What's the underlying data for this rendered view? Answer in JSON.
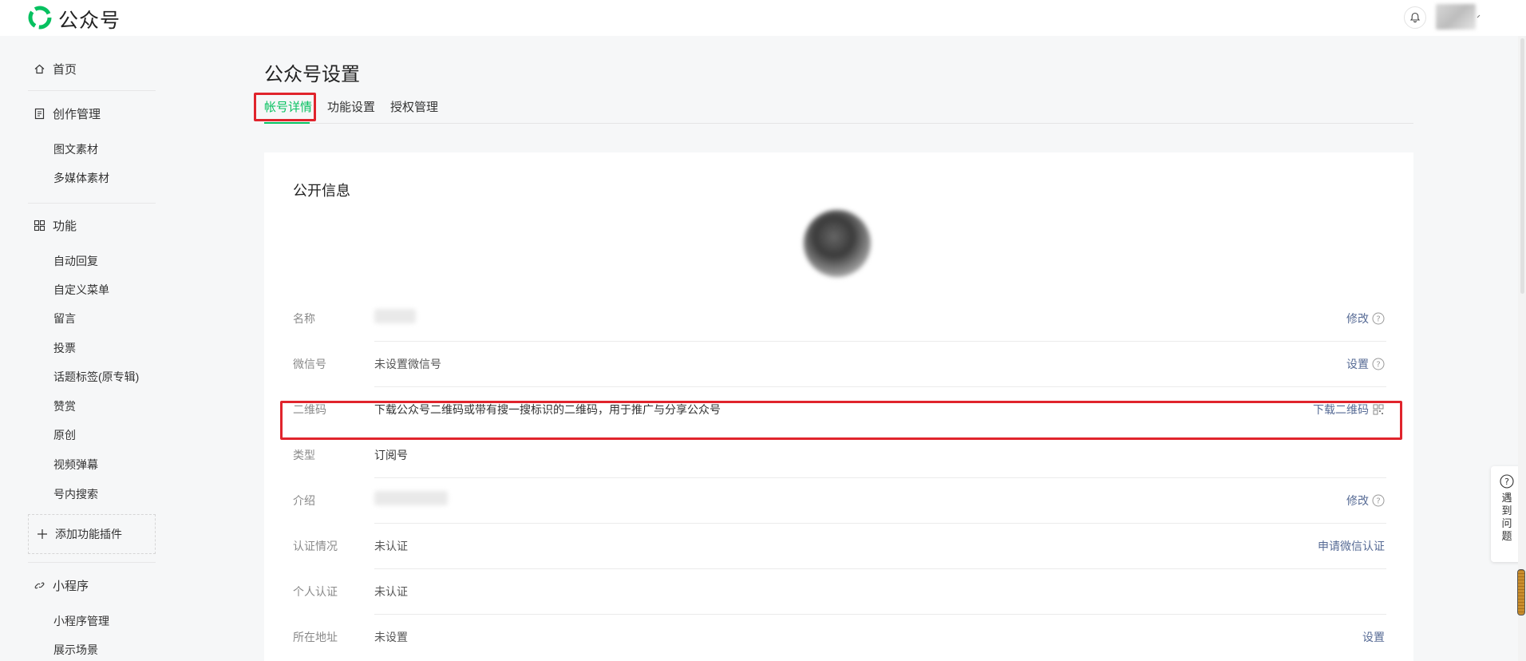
{
  "topbar": {
    "brand": "公众号",
    "brand_color": "#07c160"
  },
  "sidebar": {
    "home": "首页",
    "content": {
      "label": "创作管理",
      "items": [
        "图文素材",
        "多媒体素材"
      ]
    },
    "features": {
      "label": "功能",
      "items": [
        "自动回复",
        "自定义菜单",
        "留言",
        "投票",
        "话题标签(原专辑)",
        "赞赏",
        "原创",
        "视频弹幕",
        "号内搜索"
      ]
    },
    "add_plugin": "添加功能插件",
    "miniprogram": {
      "label": "小程序",
      "items": [
        "小程序管理",
        "展示场景"
      ]
    }
  },
  "main": {
    "title": "公众号设置",
    "tabs": [
      "帐号详情",
      "功能设置",
      "授权管理"
    ],
    "active_tab": "帐号详情",
    "section_title": "公开信息",
    "rows": [
      {
        "label": "名称",
        "value": "",
        "action": "修改"
      },
      {
        "label": "微信号",
        "value": "未设置微信号",
        "action": "设置"
      },
      {
        "label": "二维码",
        "value": "下载公众号二维码或带有搜一搜标识的二维码，用于推广与分享公众号",
        "action": "下载二维码"
      },
      {
        "label": "类型",
        "value": "订阅号",
        "action": ""
      },
      {
        "label": "介绍",
        "value": "",
        "action": "修改"
      },
      {
        "label": "认证情况",
        "value": "未认证",
        "action": "申请微信认证"
      },
      {
        "label": "个人认证",
        "value": "未认证",
        "action": ""
      },
      {
        "label": "所在地址",
        "value": "未设置",
        "action": "设置"
      }
    ]
  },
  "help": {
    "label": "遇到问题"
  },
  "colors": {
    "accent_green": "#07c160",
    "link_blue": "#576b95",
    "highlight_red": "#e0242c"
  }
}
